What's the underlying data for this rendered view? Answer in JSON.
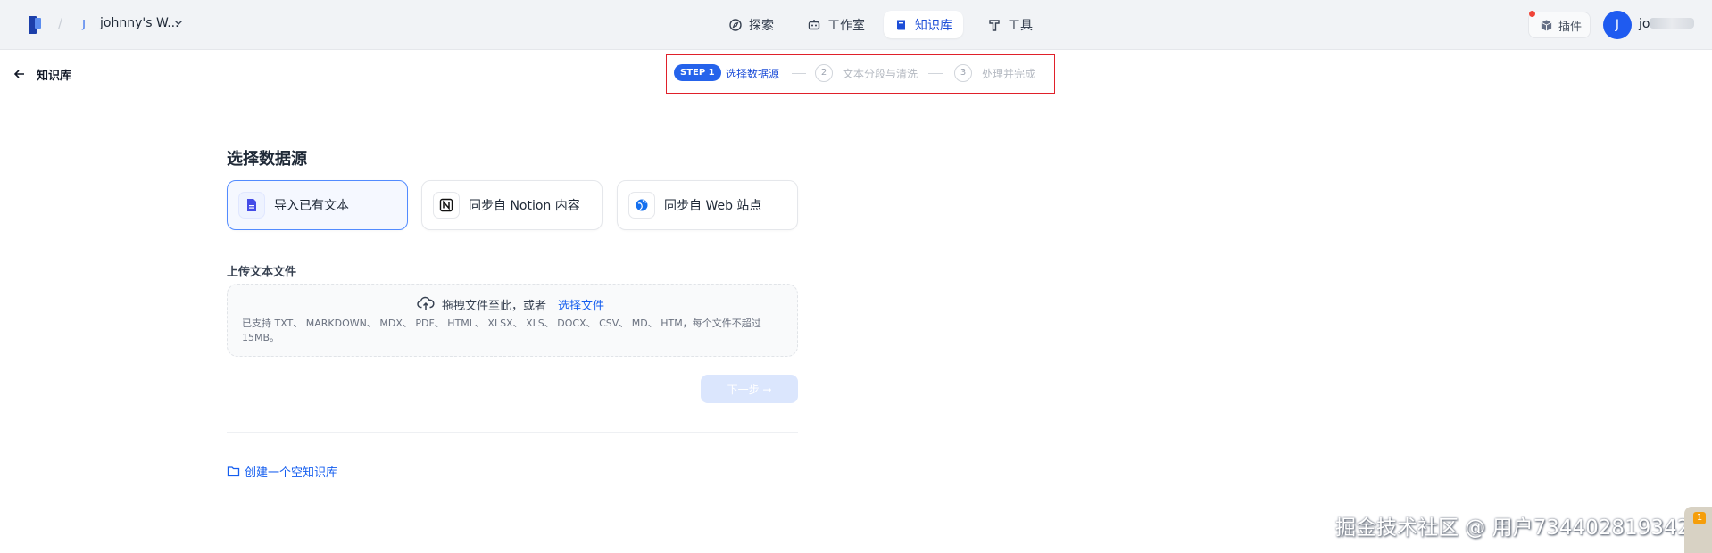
{
  "header": {
    "workspace_initial": "J",
    "workspace_name": "johnny's W...",
    "nav": [
      {
        "label": "探索",
        "icon": "compass-icon"
      },
      {
        "label": "工作室",
        "icon": "robot-icon"
      },
      {
        "label": "知识库",
        "icon": "book-icon",
        "active": true
      },
      {
        "label": "工具",
        "icon": "hammer-icon"
      }
    ],
    "plugin_label": "插件",
    "user_initial": "J",
    "user_name": "jo"
  },
  "subheader": {
    "back_label": "知识库",
    "steps": [
      {
        "badge": "STEP 1",
        "label": "选择数据源",
        "state": "active"
      },
      {
        "number": "2",
        "label": "文本分段与清洗",
        "state": "pending"
      },
      {
        "number": "3",
        "label": "处理并完成",
        "state": "pending"
      }
    ]
  },
  "main": {
    "title": "选择数据源",
    "sources": [
      {
        "label": "导入已有文本",
        "icon": "document-icon",
        "selected": true
      },
      {
        "label": "同步自 Notion 内容",
        "icon": "notion-icon",
        "selected": false
      },
      {
        "label": "同步自 Web 站点",
        "icon": "globe-icon",
        "selected": false
      }
    ],
    "upload_label": "上传文本文件",
    "drop_text": "拖拽文件至此，或者",
    "drop_link": "选择文件",
    "drop_hint": "已支持 TXT、 MARKDOWN、 MDX、 PDF、 HTML、 XLSX、 XLS、 DOCX、 CSV、 MD、 HTM，每个文件不超过 15MB。",
    "next_label": "下一步 →",
    "create_empty_label": "创建一个空知识库"
  },
  "watermark": "掘金技术社区 @ 用户734402819342",
  "corner_badge": "1",
  "colors": {
    "accent": "#155eef",
    "step_highlight_border": "#e0202a",
    "avatar": "#1f5bf0"
  }
}
